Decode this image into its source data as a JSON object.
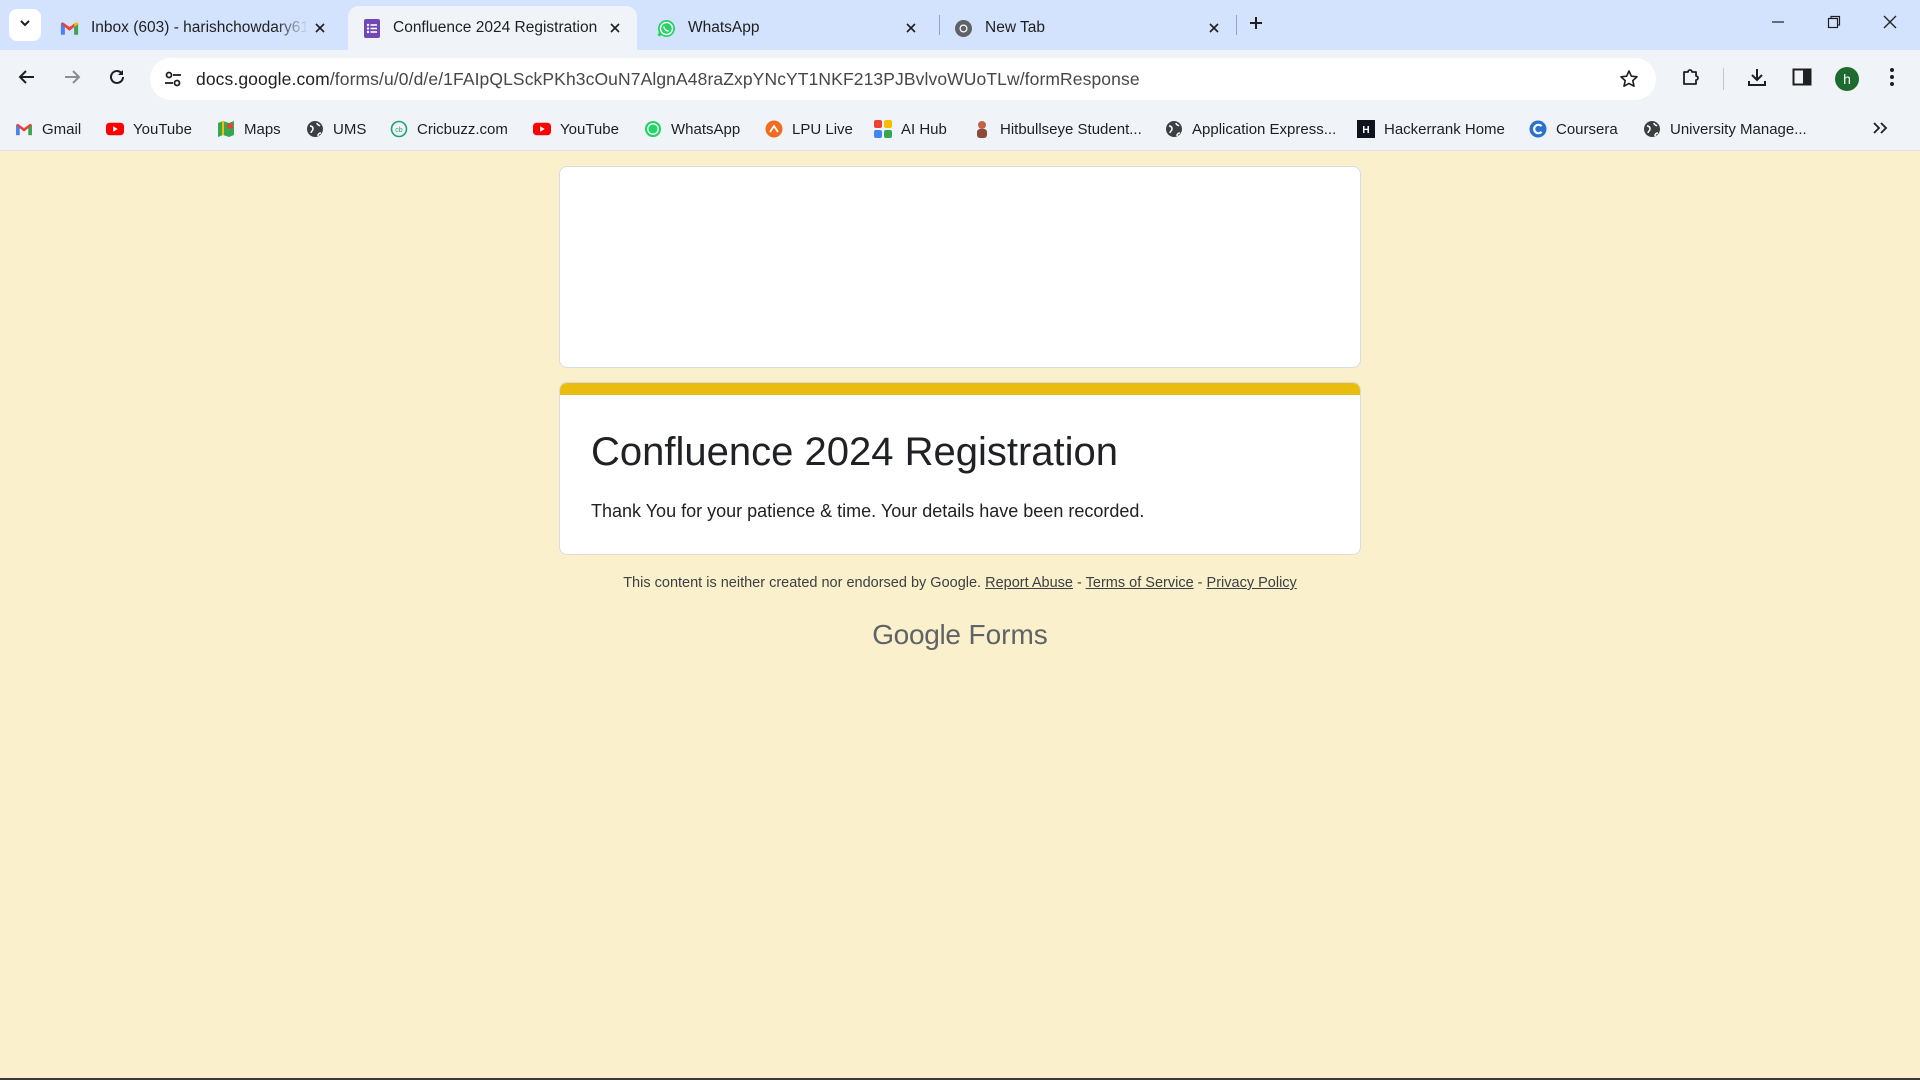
{
  "browser": {
    "tabs": [
      {
        "title": "Inbox (603) - harishchowdary61",
        "icon": "gmail-icon"
      },
      {
        "title": "Confluence 2024 Registration",
        "icon": "google-forms-icon",
        "active": true
      },
      {
        "title": "WhatsApp",
        "icon": "whatsapp-icon"
      },
      {
        "title": "New Tab",
        "icon": "chrome-icon"
      }
    ],
    "url": {
      "host": "docs.google.com",
      "path": "/forms/u/0/d/e/1FAIpQLSckPKh3cOuN7AlgnA48raZxpYNcYT1NKF213PJBvlvoWUoTLw/formResponse"
    },
    "profile_initial": "h",
    "bookmarks": [
      {
        "label": "Gmail",
        "icon": "gmail-icon"
      },
      {
        "label": "YouTube",
        "icon": "youtube-icon"
      },
      {
        "label": "Maps",
        "icon": "maps-icon"
      },
      {
        "label": "UMS",
        "icon": "globe-icon"
      },
      {
        "label": "Cricbuzz.com",
        "icon": "cricbuzz-icon"
      },
      {
        "label": "YouTube",
        "icon": "youtube-icon"
      },
      {
        "label": "WhatsApp",
        "icon": "whatsapp-icon"
      },
      {
        "label": "LPU Live",
        "icon": "lpu-live-icon"
      },
      {
        "label": "AI Hub",
        "icon": "ai-hub-icon"
      },
      {
        "label": "Hitbullseye Student...",
        "icon": "hitbullseye-icon"
      },
      {
        "label": "Application Express...",
        "icon": "globe-icon"
      },
      {
        "label": "Hackerrank Home",
        "icon": "hackerrank-icon"
      },
      {
        "label": "Coursera",
        "icon": "coursera-icon"
      },
      {
        "label": "University Manage...",
        "icon": "globe-icon"
      }
    ]
  },
  "form": {
    "title": "Confluence 2024 Registration",
    "message": "Thank You for your patience & time. Your details have been recorded.",
    "accent_color": "#e8bd10",
    "background_color": "#faf0cb"
  },
  "footer": {
    "disclaimer": "This content is neither created nor endorsed by Google.",
    "report_abuse": "Report Abuse",
    "sep": "-",
    "terms": "Terms of Service",
    "privacy": "Privacy Policy",
    "brand_google": "Google",
    "brand_forms": "Forms"
  }
}
